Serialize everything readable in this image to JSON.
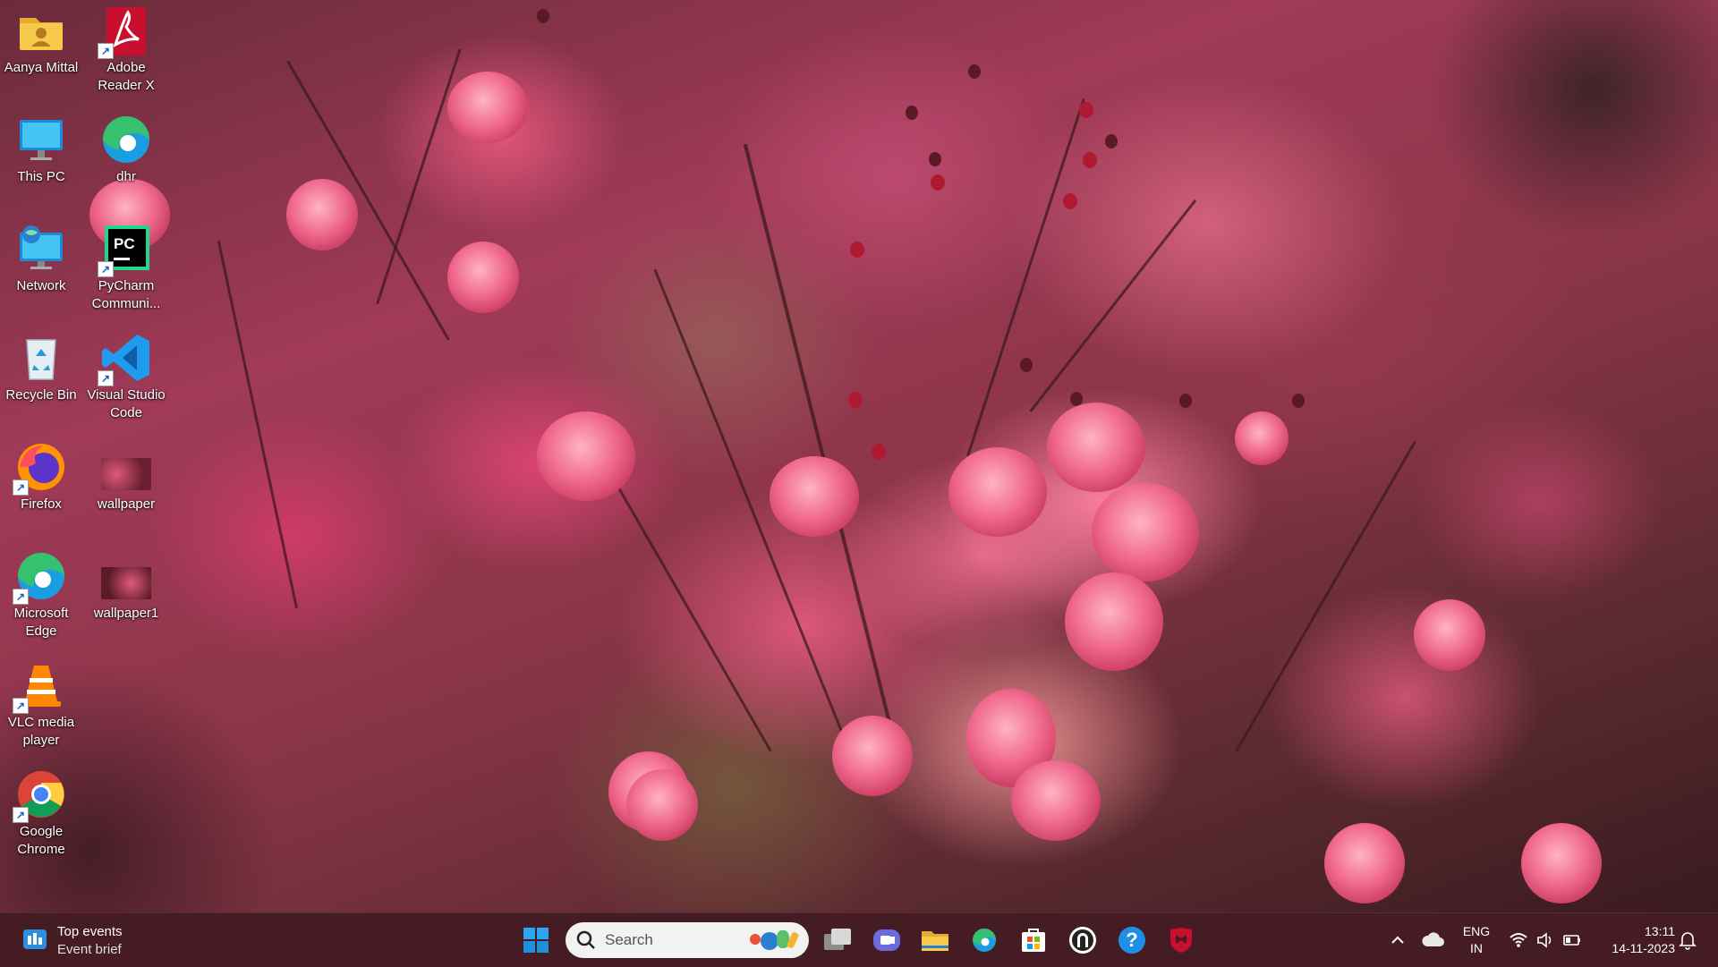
{
  "desktop": {
    "icons": [
      {
        "label_1": "Aanya Mittal",
        "label_2": "",
        "icon": "user-folder-icon"
      },
      {
        "label_1": "This PC",
        "label_2": "",
        "icon": "this-pc-icon"
      },
      {
        "label_1": "Network",
        "label_2": "",
        "icon": "network-icon"
      },
      {
        "label_1": "Recycle Bin",
        "label_2": "",
        "icon": "recycle-bin-icon"
      },
      {
        "label_1": "Firefox",
        "label_2": "",
        "icon": "firefox-icon"
      },
      {
        "label_1": "Microsoft",
        "label_2": "Edge",
        "icon": "edge-icon"
      },
      {
        "label_1": "VLC media",
        "label_2": "player",
        "icon": "vlc-icon"
      },
      {
        "label_1": "Google",
        "label_2": "Chrome",
        "icon": "chrome-icon"
      },
      {
        "label_1": "Adobe",
        "label_2": "Reader X",
        "icon": "adobe-reader-icon"
      },
      {
        "label_1": "dhr",
        "label_2": "",
        "icon": "edge-icon"
      },
      {
        "label_1": "PyCharm",
        "label_2": "Communi...",
        "icon": "pycharm-icon"
      },
      {
        "label_1": "Visual Studio",
        "label_2": "Code",
        "icon": "vscode-icon"
      },
      {
        "label_1": "wallpaper",
        "label_2": "",
        "icon": "image-thumbnail-icon"
      },
      {
        "label_1": "wallpaper1",
        "label_2": "",
        "icon": "image-thumbnail-icon"
      }
    ]
  },
  "taskbar": {
    "widget": {
      "title": "Top events",
      "subtitle": "Event brief"
    },
    "search": {
      "placeholder": "Search"
    },
    "pinned": [
      "start-icon",
      "task-view-icon",
      "teams-chat-icon",
      "file-explorer-icon",
      "edge-icon",
      "microsoft-store-icon",
      "app-icon",
      "help-icon",
      "mcafee-icon"
    ],
    "tray": {
      "language_1": "ENG",
      "language_2": "IN",
      "time": "13:11",
      "date": "14-11-2023"
    }
  },
  "colors": {
    "taskbar_bg": "#461c24",
    "accent_blue": "#1a8ad6"
  }
}
